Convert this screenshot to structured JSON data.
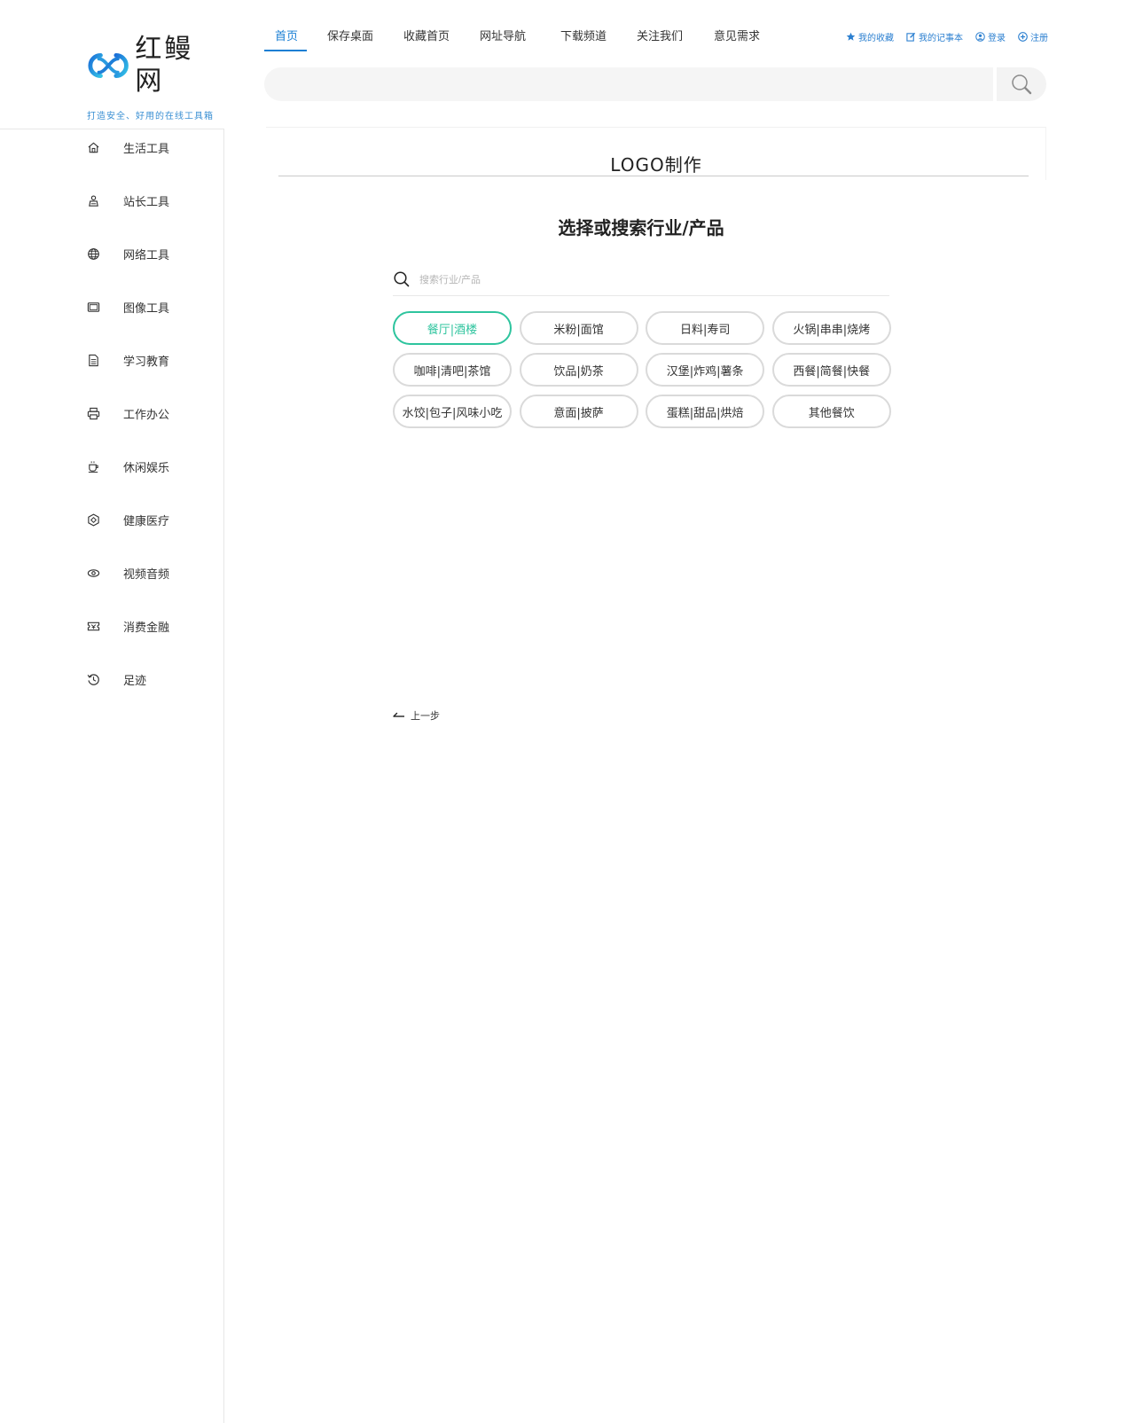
{
  "brand": {
    "name": "红鳗网",
    "slogan": "打造安全、好用的在线工具箱",
    "accent": "#1a7fd4",
    "highlight": "#2ec49e"
  },
  "topnav": {
    "items": [
      {
        "label": "首页",
        "active": true
      },
      {
        "label": "保存桌面"
      },
      {
        "label": "收藏首页"
      },
      {
        "label": "网址导航"
      },
      {
        "label": "下载频道"
      },
      {
        "label": "关注我们"
      },
      {
        "label": "意见需求"
      }
    ]
  },
  "userlinks": [
    {
      "label": "我的收藏",
      "icon": "star-icon"
    },
    {
      "label": "我的记事本",
      "icon": "edit-icon"
    },
    {
      "label": "登录",
      "icon": "user-icon"
    },
    {
      "label": "注册",
      "icon": "plus-circle-icon"
    }
  ],
  "search": {
    "value": "",
    "placeholder": ""
  },
  "sidebar": {
    "items": [
      {
        "label": "生活工具",
        "icon": "home-icon"
      },
      {
        "label": "站长工具",
        "icon": "person-icon"
      },
      {
        "label": "网络工具",
        "icon": "globe-icon"
      },
      {
        "label": "图像工具",
        "icon": "image-icon"
      },
      {
        "label": "学习教育",
        "icon": "document-icon"
      },
      {
        "label": "工作办公",
        "icon": "printer-icon"
      },
      {
        "label": "休闲娱乐",
        "icon": "coffee-icon"
      },
      {
        "label": "健康医疗",
        "icon": "shield-icon"
      },
      {
        "label": "视频音频",
        "icon": "eye-icon"
      },
      {
        "label": "消费金融",
        "icon": "ticket-icon"
      },
      {
        "label": "足迹",
        "icon": "history-icon"
      }
    ]
  },
  "main": {
    "title": "LOGO制作",
    "heading": "选择或搜索行业/产品",
    "industry_search": {
      "value": "",
      "placeholder": "搜索行业/产品"
    },
    "chips": [
      {
        "label": "餐厅|酒楼",
        "selected": true
      },
      {
        "label": "米粉|面馆"
      },
      {
        "label": "日料|寿司"
      },
      {
        "label": "火锅|串串|烧烤"
      },
      {
        "label": "咖啡|清吧|茶馆"
      },
      {
        "label": "饮品|奶茶"
      },
      {
        "label": "汉堡|炸鸡|薯条"
      },
      {
        "label": "西餐|简餐|快餐"
      },
      {
        "label": "水饺|包子|风味小吃"
      },
      {
        "label": "意面|披萨"
      },
      {
        "label": "蛋糕|甜品|烘焙"
      },
      {
        "label": "其他餐饮"
      }
    ],
    "prev_label": "上一步"
  }
}
